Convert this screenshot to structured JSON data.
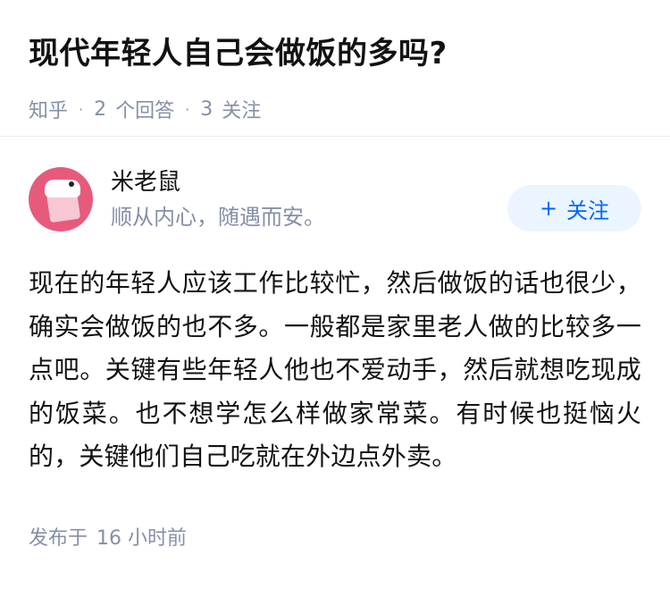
{
  "question": {
    "title": "现代年轻人自己会做饭的多吗?",
    "source": "知乎",
    "answers_count": "2",
    "answers_label": "个回答",
    "followers_count": "3",
    "followers_label": "关注"
  },
  "answer": {
    "author_name": "米老鼠",
    "author_bio": "顺从内心，随遇而安。",
    "follow_button": {
      "icon": "plus-icon",
      "plus": "+",
      "label": "关注"
    },
    "content": "现在的年轻人应该工作比较忙，然后做饭的话也很少，确实会做饭的也不多。一般都是家里老人做的比较多一点吧。关键有些年轻人他也不爱动手，然后就想吃现成的饭菜。也不想学怎么样做家常菜。有时候也挺恼火的，关键他们自己吃就在外边点外卖。",
    "published_label": "发布于",
    "published_time": "16 小时前"
  },
  "colors": {
    "muted": "#8590a6",
    "accent": "#0066ff",
    "follow_bg": "#ebf5ff",
    "avatar_bg": "#e75a7c"
  }
}
